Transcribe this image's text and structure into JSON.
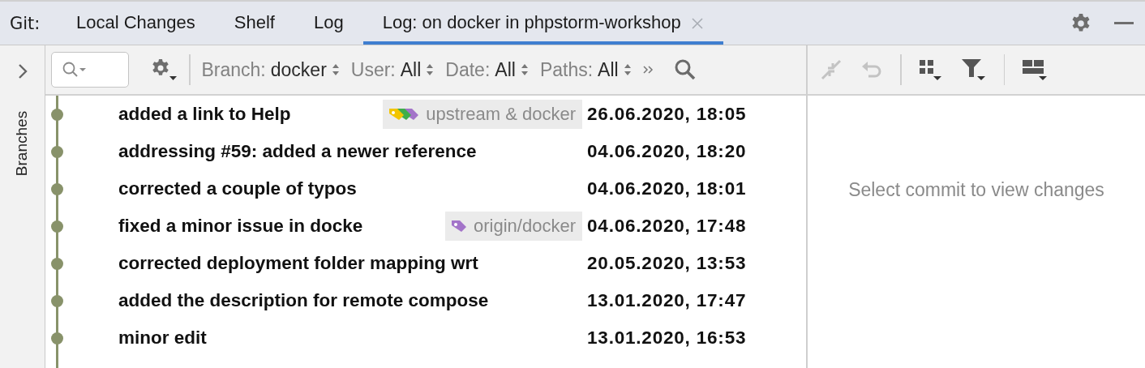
{
  "tool_window": {
    "label": "Git:"
  },
  "tabs": [
    {
      "label": "Local Changes",
      "selected": false
    },
    {
      "label": "Shelf",
      "selected": false
    },
    {
      "label": "Log",
      "selected": false
    },
    {
      "label": "Log: on docker in phpstorm-workshop",
      "selected": true,
      "closable": true
    }
  ],
  "side_panel": {
    "label": "Branches",
    "expanded": false
  },
  "filters": [
    {
      "label": "Branch:",
      "value": "docker"
    },
    {
      "label": "User:",
      "value": "All"
    },
    {
      "label": "Date:",
      "value": "All"
    },
    {
      "label": "Paths:",
      "value": "All"
    }
  ],
  "details_toolbar": [
    {
      "kind": "cherry-pick",
      "disabled": true
    },
    {
      "kind": "revert",
      "disabled": true
    },
    {
      "kind": "separator"
    },
    {
      "kind": "group",
      "disabled": false
    },
    {
      "kind": "filter",
      "disabled": false
    },
    {
      "kind": "separator"
    },
    {
      "kind": "layout",
      "disabled": false
    }
  ],
  "commits": [
    {
      "subject": "added a link to Help",
      "date": "26.06.2020, 18:05",
      "tags": [
        {
          "label": "upstream & docker",
          "markers": [
            {
              "color": "#f2c500"
            },
            {
              "color": "#3fae4a"
            },
            {
              "color": "#a374c9"
            }
          ]
        }
      ]
    },
    {
      "subject": "addressing #59: added a newer reference",
      "date": "04.06.2020, 18:20"
    },
    {
      "subject": "corrected a couple of typos",
      "date": "04.06.2020, 18:01"
    },
    {
      "subject": "fixed a minor issue in docke",
      "date": "04.06.2020, 17:48",
      "tags": [
        {
          "label": "origin/docker",
          "markers": [
            {
              "color": "#a374c9"
            }
          ]
        }
      ]
    },
    {
      "subject": "corrected deployment folder mapping wrt",
      "date": "20.05.2020, 13:53"
    },
    {
      "subject": "added the description for remote compose",
      "date": "13.01.2020, 17:47"
    },
    {
      "subject": "minor edit",
      "date": "13.01.2020, 16:53"
    }
  ],
  "details": {
    "empty_text": "Select commit to view changes"
  }
}
